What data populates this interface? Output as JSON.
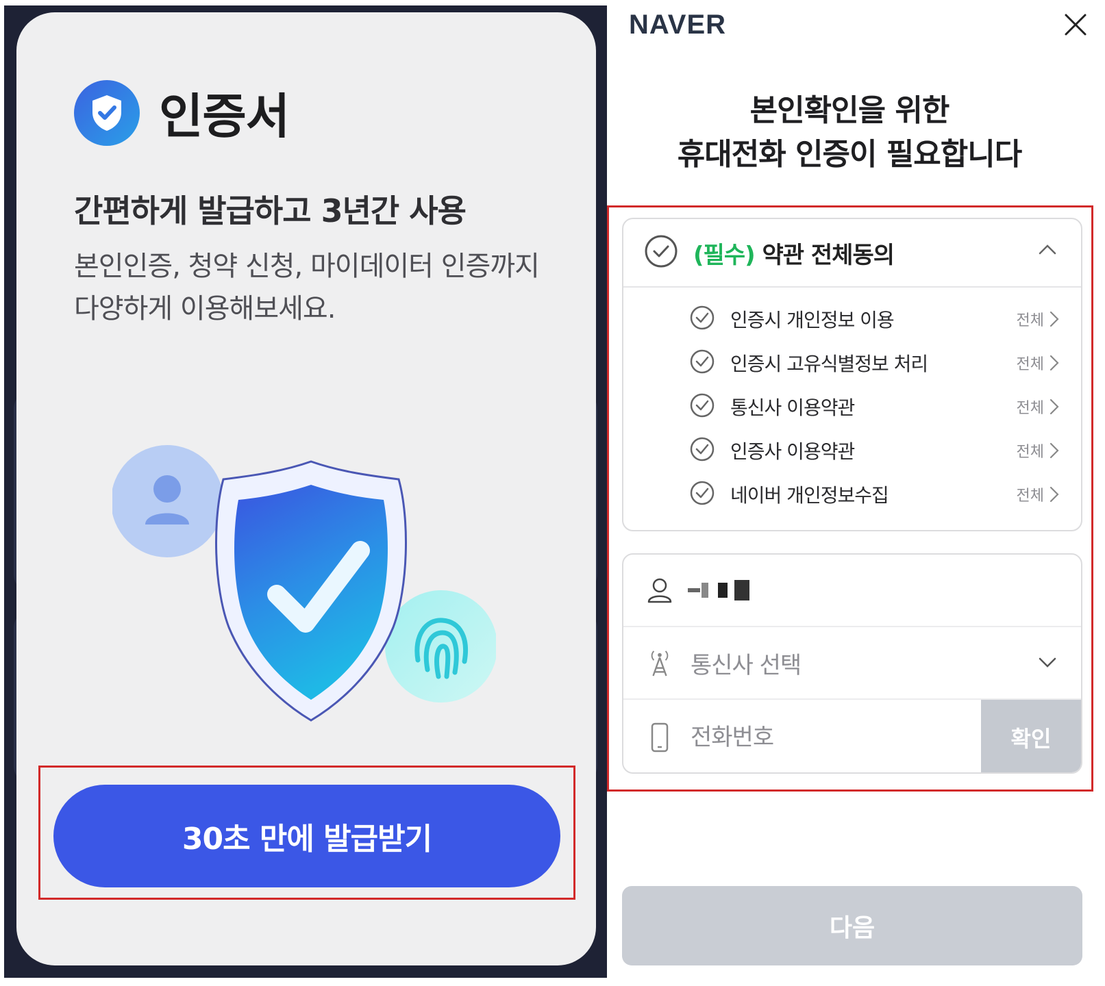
{
  "left": {
    "logo_title": "인증서",
    "headline": "간편하게 발급하고 3년간 사용",
    "description_line1": "본인인증, 청약 신청, 마이데이터 인증까지",
    "description_line2": "다양하게 이용해보세요.",
    "cta_label": "30초 만에 발급받기"
  },
  "right": {
    "brand": "NAVER",
    "title_line1": "본인확인을 위한",
    "title_line2": "휴대전화 인증이 필요합니다",
    "terms": {
      "required_tag": "(필수)",
      "all_agree_label": "약관 전체동의",
      "items": [
        {
          "label": "인증시 개인정보 이용",
          "link": "전체"
        },
        {
          "label": "인증시 고유식별정보 처리",
          "link": "전체"
        },
        {
          "label": "통신사 이용약관",
          "link": "전체"
        },
        {
          "label": "인증사 이용약관",
          "link": "전체"
        },
        {
          "label": "네이버 개인정보수집",
          "link": "전체"
        }
      ]
    },
    "form": {
      "carrier_placeholder": "통신사 선택",
      "phone_placeholder": "전화번호",
      "confirm_label": "확인"
    },
    "next_label": "다음"
  },
  "colors": {
    "primary_blue": "#3b57e6",
    "required_green": "#1fb55a",
    "disabled_gray": "#c9cdd4",
    "highlight_red": "#d22a2a"
  }
}
